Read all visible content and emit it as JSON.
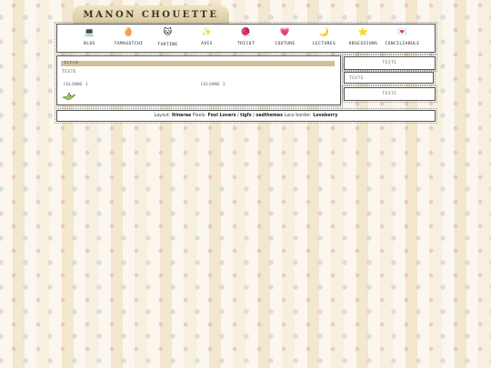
{
  "site": {
    "title": "MANON CHOUETTE"
  },
  "nav": [
    {
      "icon": "computer-icon",
      "glyph": "💻",
      "label": "BLOG"
    },
    {
      "icon": "tamagotchi-icon",
      "glyph": "🥚",
      "label": "TAMAGOTCHI"
    },
    {
      "icon": "cat-icon",
      "glyph": "🐱",
      "label": "TARTINE"
    },
    {
      "icon": "sparkle-icon",
      "glyph": "✨",
      "label": "AVIS"
    },
    {
      "icon": "yarn-icon",
      "glyph": "🧶",
      "label": "TRICOT"
    },
    {
      "icon": "heart-icon",
      "glyph": "💗",
      "label": "COUTURE"
    },
    {
      "icon": "moon-icon",
      "glyph": "🌙",
      "label": "LECTURES"
    },
    {
      "icon": "star-icon",
      "glyph": "⭐",
      "label": "OBSESSIONS"
    },
    {
      "icon": "envelope-icon",
      "glyph": "💌",
      "label": "CONCILIABULE"
    }
  ],
  "main": {
    "title": "titre",
    "text": "TEXTE",
    "col1": "COLONNE 1",
    "col2": "COLONNE 2"
  },
  "side": [
    "TEXTE",
    "TEXTE",
    "TEXTE"
  ],
  "footer": {
    "layout_label": "Layout:",
    "layout_credit": "Itinerae",
    "pixels_label": "Pixels:",
    "pixels_credit_1": "Fool Lovers",
    "sep1": "/",
    "pixels_credit_2": "tigfx",
    "sep2": "/",
    "pixels_credit_3": "sadthemes",
    "lace_label": "Lace border:",
    "lace_credit": "Loveberry"
  }
}
